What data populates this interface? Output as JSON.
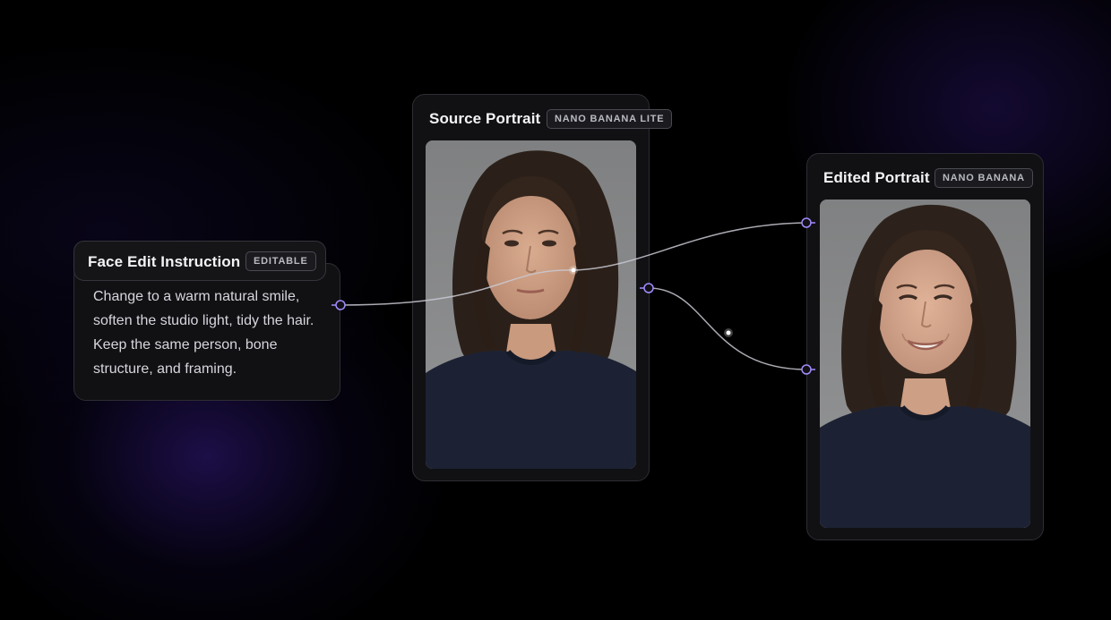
{
  "instruction_node": {
    "title": "Face Edit Instruction",
    "badge": "EDITABLE",
    "text": "Change to a warm natural smile, soften the studio light, tidy the hair. Keep the same person, bone structure, and framing."
  },
  "source_node": {
    "title": "Source Portrait",
    "badge": "NANO BANANA LITE",
    "image": "portrait of a woman with shoulder-length dark hair, neutral expression, dark navy sweater, grey background"
  },
  "edited_node": {
    "title": "Edited Portrait",
    "badge": "NANO BANANA",
    "image": "portrait of the same woman smiling, dark navy sweater, grey background"
  },
  "colors": {
    "background": "#000000",
    "node_bg": "#111114",
    "port_accent": "#a48bff",
    "wire": "#c9c9d2"
  }
}
